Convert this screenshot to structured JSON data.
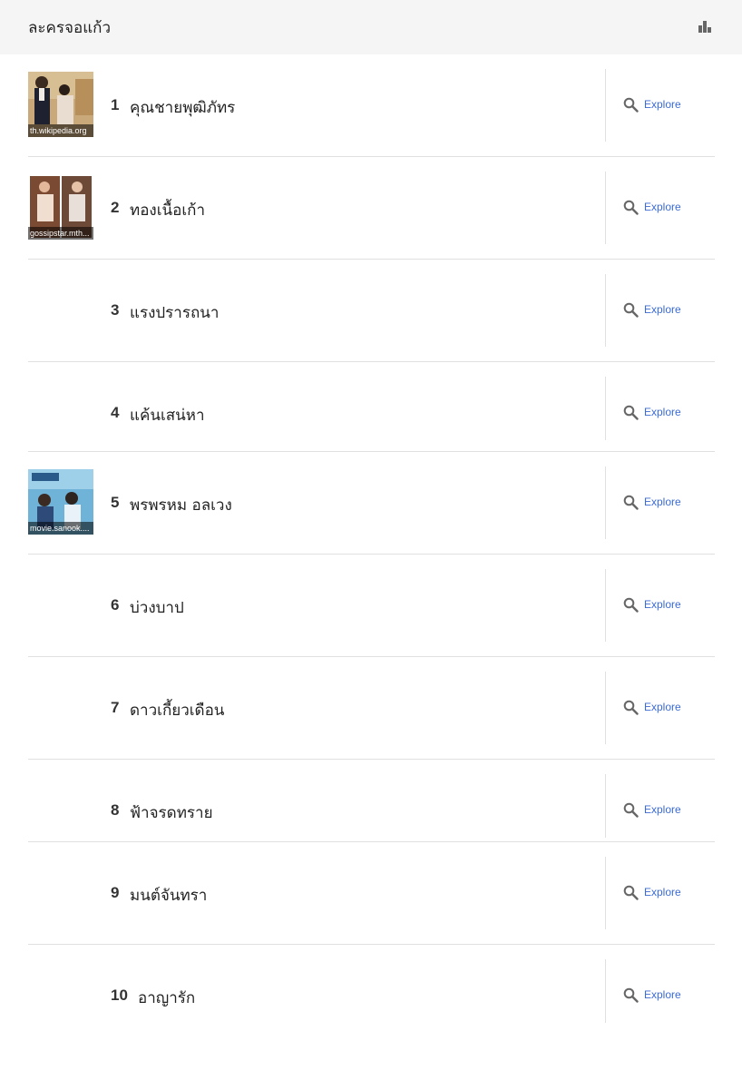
{
  "header": {
    "title": "ละครจอแก้ว",
    "chart_icon": "bar-chart-icon"
  },
  "explore_label": "Explore",
  "items": [
    {
      "rank": "1",
      "title": "คุณชายพุฒิภัทร",
      "image_source": "th.wikipedia.org"
    },
    {
      "rank": "2",
      "title": "ทองเนื้อเก้า",
      "image_source": "gossipstar.mth..."
    },
    {
      "rank": "3",
      "title": "แรงปรารถนา"
    },
    {
      "rank": "4",
      "title": "แค้นเสน่หา"
    },
    {
      "rank": "5",
      "title": "พรพรหม อลเวง",
      "image_source": "movie.sanook...."
    },
    {
      "rank": "6",
      "title": "บ่วงบาป"
    },
    {
      "rank": "7",
      "title": "ดาวเกี้ยวเดือน"
    },
    {
      "rank": "8",
      "title": "ฟ้าจรดทราย"
    },
    {
      "rank": "9",
      "title": "มนต์จันทรา"
    },
    {
      "rank": "10",
      "title": "อาญารัก"
    }
  ],
  "colors": {
    "header_bg": "#f5f5f5",
    "link": "#3b6bd4",
    "divider": "#e0e0e0"
  }
}
